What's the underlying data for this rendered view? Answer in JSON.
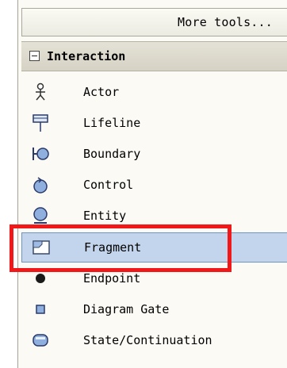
{
  "toolbox": {
    "more_tools_label": "More tools...",
    "group_title": "Interaction",
    "items": [
      {
        "label": "Actor",
        "icon": "actor-icon"
      },
      {
        "label": "Lifeline",
        "icon": "lifeline-icon"
      },
      {
        "label": "Boundary",
        "icon": "boundary-icon"
      },
      {
        "label": "Control",
        "icon": "control-icon"
      },
      {
        "label": "Entity",
        "icon": "entity-icon"
      },
      {
        "label": "Fragment",
        "icon": "fragment-icon",
        "selected": true
      },
      {
        "label": "Endpoint",
        "icon": "endpoint-icon"
      },
      {
        "label": "Diagram Gate",
        "icon": "diagram-gate-icon"
      },
      {
        "label": "State/Continuation",
        "icon": "state-continuation-icon"
      }
    ]
  },
  "colors": {
    "selection_fill": "#c3d5ec",
    "selection_border": "#6e95c4",
    "highlight_annotation": "#f01818"
  }
}
